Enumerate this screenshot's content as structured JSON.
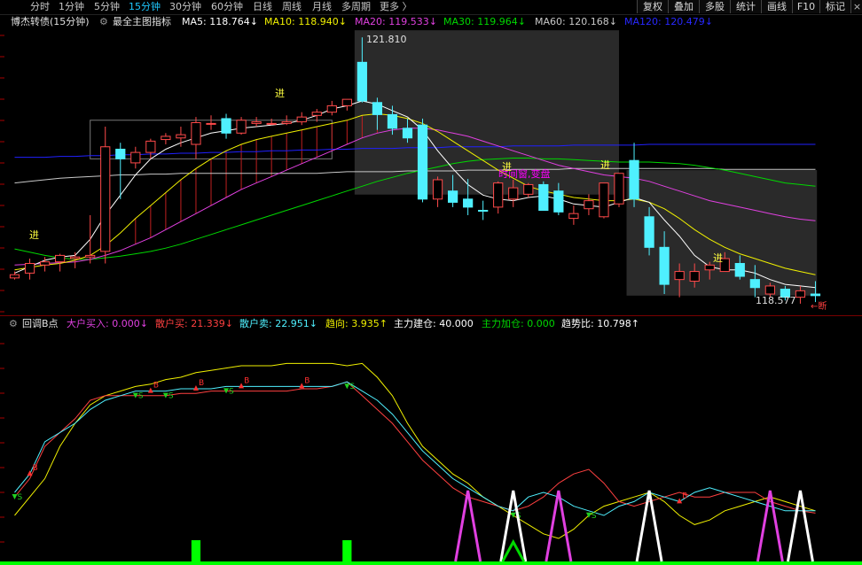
{
  "toolbar": {
    "periods": [
      "分时",
      "1分钟",
      "5分钟",
      "15分钟",
      "30分钟",
      "60分钟",
      "日线",
      "周线",
      "月线",
      "多周期",
      "更多 〉"
    ],
    "active_period": "15分钟",
    "right_buttons": [
      "复权",
      "叠加",
      "多股",
      "统计",
      "画线",
      "F10",
      "标记"
    ]
  },
  "main_legend": {
    "title": "博杰转债(15分钟)",
    "indicator_name": "最全主图指标",
    "ma5": "MA5: 118.764↓",
    "ma10": "MA10: 118.940↓",
    "ma20": "MA20: 119.533↓",
    "ma30": "MA30: 119.964↓",
    "ma60": "MA60: 120.168↓",
    "ma120": "MA120: 120.479↓"
  },
  "sub_legend": {
    "name": "回调B点",
    "big_buy": "大户买入: 0.000↓",
    "retail_buy": "散户买: 21.339↓",
    "retail_sell": "散户卖: 22.951↓",
    "trend": "趋向: 3.935↑",
    "main_build": "主力建仓: 40.000",
    "main_add": "主力加仓: 0.000",
    "trend_ratio": "趋势比: 10.798↑"
  },
  "annotations": {
    "high": "121.810",
    "low": "118.577",
    "entry": "进",
    "window_note": "时间窗,变盘",
    "low_arrow": "←断"
  },
  "colors": {
    "up": "#ff4a4a",
    "down": "#4ff0ff",
    "ma5": "#ffffff",
    "ma10": "#f0f000",
    "ma20": "#e040e0",
    "ma30": "#00d800",
    "ma60": "#c8c8c8",
    "ma120": "#2020ff",
    "entry_text": "#ffff40",
    "window_text": "#ff00ff"
  },
  "chart_data": {
    "type": "candlestick",
    "price_range": [
      118.4,
      121.9
    ],
    "candles": [
      [
        118.82,
        118.9,
        118.8,
        118.86
      ],
      [
        118.88,
        119.06,
        118.8,
        119.0
      ],
      [
        118.98,
        119.08,
        118.9,
        119.02
      ],
      [
        119.02,
        119.12,
        118.9,
        119.1
      ],
      [
        119.06,
        119.14,
        118.94,
        119.08
      ],
      [
        119.08,
        119.6,
        119.0,
        119.1
      ],
      [
        119.15,
        120.7,
        119.0,
        120.45
      ],
      [
        120.42,
        120.5,
        119.8,
        120.3
      ],
      [
        120.25,
        120.45,
        120.18,
        120.38
      ],
      [
        120.38,
        120.55,
        120.3,
        120.52
      ],
      [
        120.54,
        120.62,
        120.48,
        120.58
      ],
      [
        120.56,
        120.7,
        120.45,
        120.6
      ],
      [
        120.48,
        120.82,
        120.3,
        120.75
      ],
      [
        120.74,
        120.84,
        120.66,
        120.74
      ],
      [
        120.8,
        120.86,
        120.55,
        120.62
      ],
      [
        120.62,
        120.82,
        120.6,
        120.78
      ],
      [
        120.74,
        120.82,
        120.7,
        120.76
      ],
      [
        120.74,
        120.8,
        120.72,
        120.74
      ],
      [
        120.74,
        120.84,
        120.72,
        120.76
      ],
      [
        120.76,
        120.88,
        120.72,
        120.82
      ],
      [
        120.84,
        120.92,
        120.76,
        120.88
      ],
      [
        120.88,
        121.02,
        120.84,
        120.96
      ],
      [
        120.96,
        121.04,
        120.9,
        121.04
      ],
      [
        121.5,
        121.81,
        121.0,
        121.02
      ],
      [
        121.0,
        121.06,
        120.66,
        120.85
      ],
      [
        120.85,
        120.96,
        120.6,
        120.68
      ],
      [
        120.68,
        120.8,
        120.5,
        120.56
      ],
      [
        120.72,
        120.8,
        119.76,
        119.8
      ],
      [
        119.8,
        120.08,
        119.7,
        120.04
      ],
      [
        119.9,
        120.1,
        119.7,
        119.76
      ],
      [
        119.8,
        120.05,
        119.6,
        119.7
      ],
      [
        119.66,
        119.78,
        119.54,
        119.65
      ],
      [
        119.7,
        120.02,
        119.62,
        120.0
      ],
      [
        119.8,
        120.04,
        119.7,
        119.94
      ],
      [
        119.86,
        120.0,
        119.82,
        119.98
      ],
      [
        119.98,
        120.02,
        119.74,
        119.66
      ],
      [
        119.9,
        120.0,
        119.6,
        119.64
      ],
      [
        119.56,
        119.72,
        119.48,
        119.62
      ],
      [
        119.68,
        119.86,
        119.6,
        119.78
      ],
      [
        119.58,
        119.84,
        119.56,
        120.0
      ],
      [
        119.74,
        120.04,
        119.7,
        120.12
      ],
      [
        120.28,
        120.5,
        119.7,
        119.8
      ],
      [
        119.58,
        119.7,
        119.1,
        119.2
      ],
      [
        119.2,
        119.4,
        118.62,
        118.74
      ],
      [
        118.8,
        119.0,
        118.58,
        118.9
      ],
      [
        118.78,
        119.0,
        118.7,
        118.9
      ],
      [
        118.92,
        119.02,
        118.8,
        118.98
      ],
      [
        118.9,
        119.14,
        118.92,
        119.06
      ],
      [
        119.0,
        119.1,
        118.8,
        118.84
      ],
      [
        118.8,
        118.98,
        118.58,
        118.7
      ],
      [
        118.62,
        118.76,
        118.58,
        118.72
      ],
      [
        118.68,
        118.72,
        118.54,
        118.58
      ],
      [
        118.58,
        118.72,
        118.5,
        118.66
      ],
      [
        118.62,
        118.78,
        118.52,
        118.6
      ]
    ],
    "moving_averages": {
      "MA5": [
        118.88,
        118.96,
        119.04,
        119.08,
        119.1,
        119.3,
        119.6,
        119.85,
        120.1,
        120.3,
        120.42,
        120.5,
        120.56,
        120.62,
        120.65,
        120.68,
        120.7,
        120.72,
        120.74,
        120.78,
        120.84,
        120.92,
        120.96,
        121.02,
        120.98,
        120.9,
        120.82,
        120.66,
        120.4,
        120.18,
        119.98,
        119.85,
        119.8,
        119.78,
        119.82,
        119.84,
        119.8,
        119.74,
        119.72,
        119.7,
        119.76,
        119.82,
        119.76,
        119.54,
        119.34,
        119.1,
        118.96,
        118.92,
        118.92,
        118.88,
        118.8,
        118.74,
        118.72,
        118.7
      ],
      "MA10": [
        118.92,
        118.95,
        118.98,
        119.0,
        119.04,
        119.1,
        119.22,
        119.38,
        119.56,
        119.72,
        119.88,
        120.04,
        120.18,
        120.3,
        120.4,
        120.48,
        120.54,
        120.58,
        120.62,
        120.66,
        120.7,
        120.74,
        120.78,
        120.84,
        120.86,
        120.84,
        120.8,
        120.74,
        120.64,
        120.52,
        120.4,
        120.28,
        120.16,
        120.06,
        119.96,
        119.9,
        119.86,
        119.82,
        119.8,
        119.78,
        119.78,
        119.8,
        119.76,
        119.68,
        119.56,
        119.42,
        119.3,
        119.2,
        119.12,
        119.06,
        119.0,
        118.94,
        118.9,
        118.86
      ],
      "MA20": [
        118.98,
        118.99,
        119.0,
        119.01,
        119.02,
        119.05,
        119.1,
        119.16,
        119.24,
        119.32,
        119.42,
        119.52,
        119.62,
        119.72,
        119.82,
        119.92,
        120.0,
        120.08,
        120.16,
        120.24,
        120.32,
        120.4,
        120.48,
        120.56,
        120.62,
        120.66,
        120.68,
        120.68,
        120.66,
        120.62,
        120.58,
        120.52,
        120.46,
        120.4,
        120.34,
        120.28,
        120.22,
        120.18,
        120.14,
        120.1,
        120.08,
        120.06,
        120.02,
        119.96,
        119.9,
        119.84,
        119.78,
        119.74,
        119.7,
        119.66,
        119.62,
        119.58,
        119.55,
        119.53
      ],
      "MA30": [
        119.18,
        119.14,
        119.1,
        119.07,
        119.05,
        119.05,
        119.07,
        119.09,
        119.12,
        119.15,
        119.19,
        119.24,
        119.3,
        119.36,
        119.42,
        119.48,
        119.54,
        119.6,
        119.66,
        119.72,
        119.78,
        119.84,
        119.9,
        119.96,
        120.02,
        120.07,
        120.12,
        120.16,
        120.2,
        120.24,
        120.27,
        120.29,
        120.3,
        120.31,
        120.31,
        120.3,
        120.3,
        120.29,
        120.28,
        120.27,
        120.26,
        120.26,
        120.26,
        120.25,
        120.24,
        120.22,
        120.19,
        120.16,
        120.12,
        120.08,
        120.04,
        120.0,
        119.98,
        119.96
      ],
      "MA60": [
        120.0,
        120.02,
        120.04,
        120.06,
        120.07,
        120.08,
        120.09,
        120.1,
        120.1,
        120.11,
        120.11,
        120.12,
        120.12,
        120.12,
        120.12,
        120.12,
        120.12,
        120.12,
        120.12,
        120.12,
        120.12,
        120.13,
        120.14,
        120.14,
        120.14,
        120.14,
        120.15,
        120.15,
        120.15,
        120.15,
        120.16,
        120.16,
        120.16,
        120.17,
        120.17,
        120.17,
        120.17,
        120.18,
        120.18,
        120.18,
        120.18,
        120.18,
        120.18,
        120.18,
        120.18,
        120.18,
        120.18,
        120.17,
        120.17,
        120.17,
        120.17,
        120.17,
        120.17,
        120.17
      ],
      "MA120": [
        120.32,
        120.32,
        120.32,
        120.33,
        120.33,
        120.34,
        120.34,
        120.35,
        120.35,
        120.36,
        120.36,
        120.37,
        120.37,
        120.38,
        120.38,
        120.39,
        120.39,
        120.4,
        120.4,
        120.41,
        120.41,
        120.42,
        120.42,
        120.43,
        120.43,
        120.43,
        120.44,
        120.44,
        120.44,
        120.45,
        120.45,
        120.45,
        120.45,
        120.46,
        120.46,
        120.46,
        120.46,
        120.47,
        120.47,
        120.47,
        120.47,
        120.47,
        120.48,
        120.48,
        120.48,
        120.48,
        120.48,
        120.48,
        120.48,
        120.48,
        120.48,
        120.48,
        120.48,
        120.48
      ]
    },
    "sub_range": [
      0,
      100
    ],
    "sub_series": {
      "trend": [
        20,
        28,
        36,
        50,
        60,
        68,
        72,
        74,
        76,
        77,
        79,
        80,
        82,
        83,
        84,
        85,
        85,
        85,
        86,
        86,
        86,
        86,
        85,
        86,
        80,
        72,
        60,
        50,
        44,
        38,
        34,
        28,
        24,
        20,
        16,
        12,
        10,
        14,
        20,
        24,
        26,
        28,
        30,
        26,
        20,
        16,
        18,
        22,
        24,
        26,
        28,
        26,
        24,
        22
      ],
      "retail_sell": [
        30,
        38,
        52,
        56,
        60,
        66,
        70,
        72,
        74,
        74,
        74,
        75,
        75,
        75,
        76,
        76,
        76,
        76,
        76,
        76,
        76,
        76,
        78,
        74,
        70,
        64,
        56,
        48,
        42,
        36,
        32,
        28,
        24,
        22,
        28,
        30,
        28,
        24,
        22,
        20,
        24,
        26,
        30,
        28,
        26,
        30,
        32,
        30,
        28,
        26,
        24,
        22,
        22,
        22
      ],
      "retail_buy": [
        28,
        36,
        50,
        56,
        62,
        70,
        72,
        72,
        72,
        72,
        72,
        73,
        73,
        74,
        74,
        74,
        74,
        74,
        74,
        75,
        75,
        76,
        78,
        72,
        66,
        60,
        52,
        44,
        38,
        32,
        28,
        26,
        24,
        22,
        24,
        28,
        34,
        38,
        40,
        34,
        26,
        24,
        26,
        28,
        30,
        28,
        28,
        30,
        30,
        30,
        26,
        24,
        22,
        21
      ]
    }
  }
}
